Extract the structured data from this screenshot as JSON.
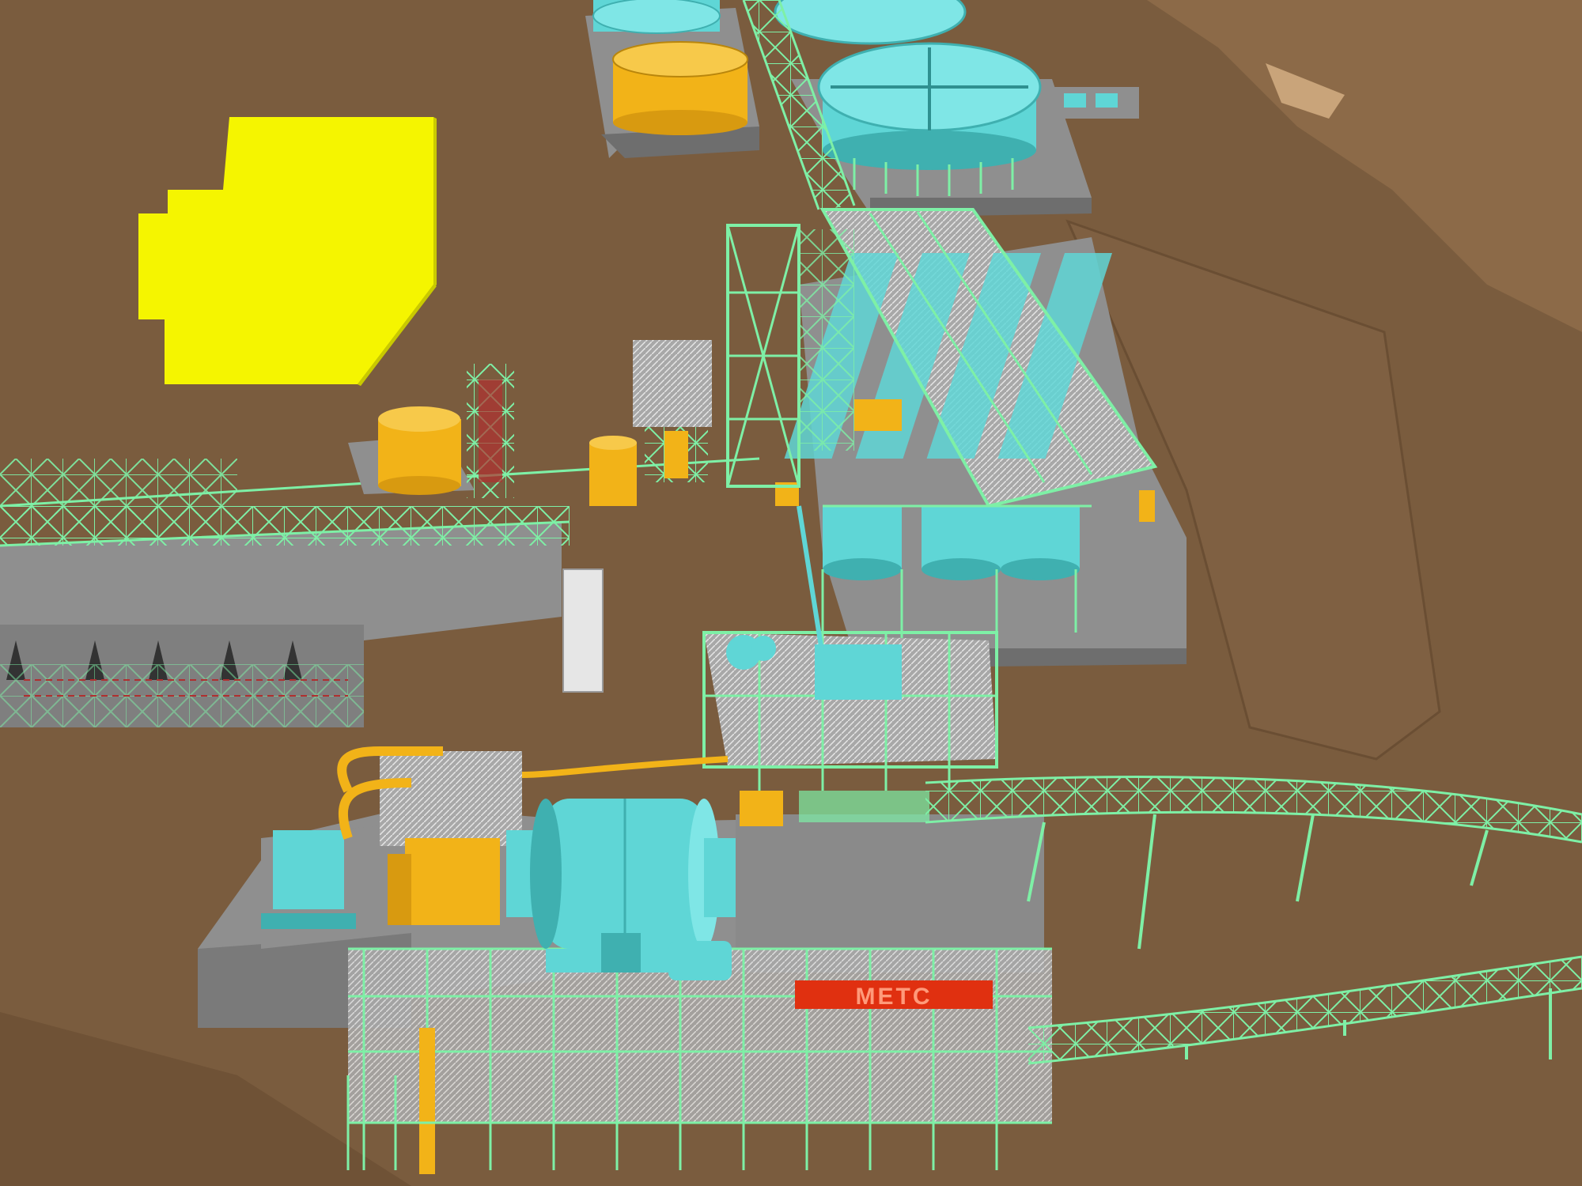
{
  "scene": {
    "signage": {
      "text": "METC"
    }
  },
  "colors": {
    "terrain": "#7a5c3e",
    "terrain_light": "#8c6a48",
    "pad": "#8f8f8f",
    "pad_dark": "#6e6e6e",
    "steel": "#7ef0a6",
    "equipment": "#5fd6d6",
    "equipment_dark": "#3fb0b0",
    "tank_orange": "#f2b318",
    "building_yellow": "#f5f500",
    "building_yellow_side": "#c9c900",
    "pump_red": "#b03030",
    "sign_red": "#e03010",
    "grating": "#c8c8c8"
  },
  "icons": [
    "ball-mill-icon",
    "thickener-tank-icon",
    "flotation-cell-icon",
    "conveyor-icon",
    "storage-tank-icon"
  ]
}
